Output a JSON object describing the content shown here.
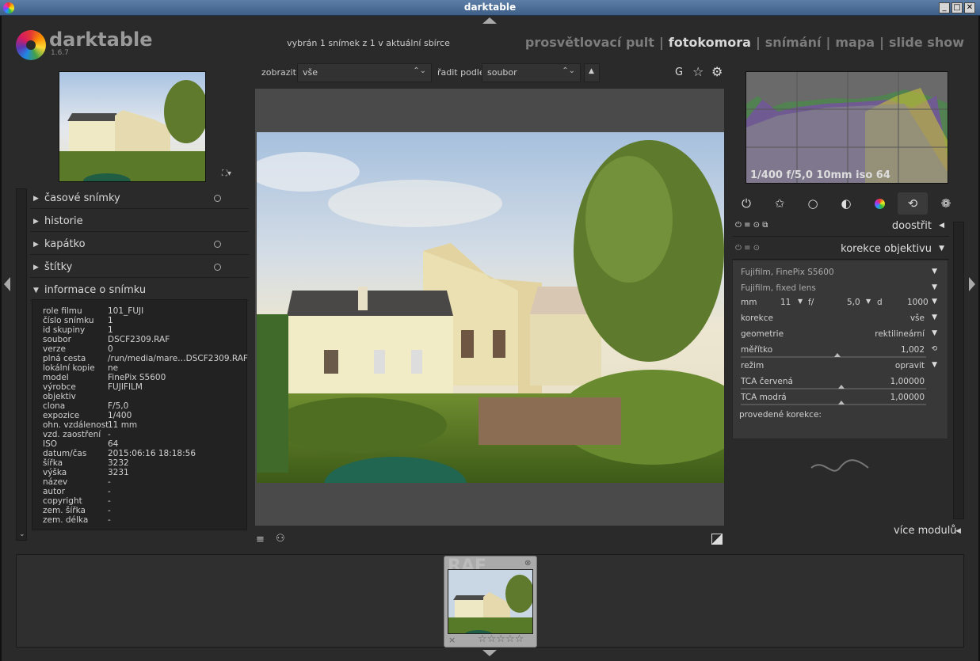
{
  "window": {
    "title": "darktable"
  },
  "header": {
    "app_name": "darktable",
    "version": "1.6.7",
    "selection_info": "vybrán 1 snímek z 1 v aktuální sbírce",
    "views": [
      "prosvětlovací pult",
      "fotokomora",
      "snímání",
      "mapa",
      "slide show"
    ],
    "active_view": "fotokomora",
    "separator": "|"
  },
  "toolbar": {
    "show_label": "zobrazit",
    "show_value": "vše",
    "sort_label": "řadit podle",
    "sort_value": "soubor",
    "grouping_label": "G"
  },
  "left_modules": [
    "časové snímky",
    "historie",
    "kapátko",
    "štítky",
    "informace o snímku"
  ],
  "image_info": [
    [
      "role filmu",
      "101_FUJI"
    ],
    [
      "číslo snímku",
      "1"
    ],
    [
      "id skupiny",
      "1"
    ],
    [
      "soubor",
      "DSCF2309.RAF"
    ],
    [
      "verze",
      "0"
    ],
    [
      "plná cesta",
      "/run/media/mare…DSCF2309.RAF"
    ],
    [
      "lokální kopie",
      "ne"
    ],
    [
      "model",
      "FinePix S5600"
    ],
    [
      "výrobce",
      "FUJIFILM"
    ],
    [
      "objektiv",
      ""
    ],
    [
      "clona",
      "F/5,0"
    ],
    [
      "expozice",
      "1/400"
    ],
    [
      "ohn. vzdálenost",
      "11 mm"
    ],
    [
      "vzd. zaostření",
      "-"
    ],
    [
      "ISO",
      "64"
    ],
    [
      "datum/čas",
      "2015:06:16 18:18:56"
    ],
    [
      "šířka",
      "3232"
    ],
    [
      "výška",
      "3231"
    ],
    [
      "název",
      "-"
    ],
    [
      "autor",
      "-"
    ],
    [
      "copyright",
      "-"
    ],
    [
      "zem. šířka",
      "-"
    ],
    [
      "zem. délka",
      "-"
    ]
  ],
  "histogram": {
    "info": "1/400 f/5,0 10mm iso 64"
  },
  "module_groups": [
    "power-icon",
    "star-icon",
    "circle-icon",
    "tone-icon",
    "color-icon",
    "correct-icon",
    "effect-icon"
  ],
  "right_panel": {
    "sharpen_label": "doostřit",
    "lens_label": "korekce objektivu",
    "camera": "Fujifilm, FinePix S5600",
    "lens": "Fujifilm, fixed lens",
    "mm_label": "mm",
    "mm_value": "11",
    "f_label": "f/",
    "f_value": "5,0",
    "d_label": "d",
    "d_value": "1000",
    "rows": [
      {
        "label": "korekce",
        "value": "vše"
      },
      {
        "label": "geometrie",
        "value": "rektilineární"
      },
      {
        "label": "měřítko",
        "value": "1,002"
      },
      {
        "label": "režim",
        "value": "opravit"
      },
      {
        "label": "TCA červená",
        "value": "1,00000"
      },
      {
        "label": "TCA modrá",
        "value": "1,00000"
      }
    ],
    "corrections_label": "provedené korekce:",
    "more_modules": "více modulů"
  },
  "filmstrip": {
    "ext_label": "RAF",
    "stars": "☆☆☆☆☆",
    "reject": "×"
  }
}
